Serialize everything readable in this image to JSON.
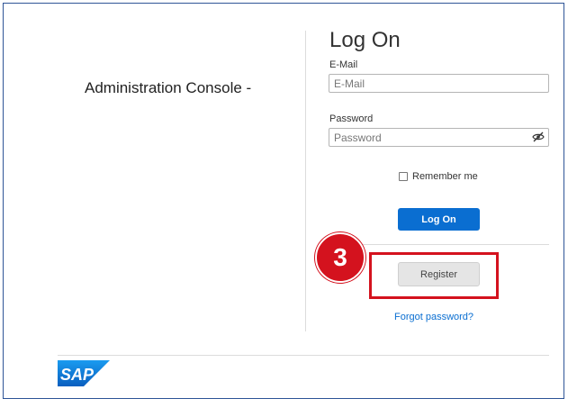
{
  "console": {
    "title": "Administration Console -"
  },
  "login": {
    "title": "Log On",
    "email_label": "E-Mail",
    "email_placeholder": "E-Mail",
    "password_label": "Password",
    "password_placeholder": "Password",
    "remember_label": "Remember me",
    "logon_button": "Log On",
    "register_button": "Register",
    "forgot_link": "Forgot password?"
  },
  "annotation": {
    "step_number": "3",
    "highlight_color": "#d4121e"
  },
  "icons": {
    "password_toggle": "eye-slash-icon",
    "brand": "sap-logo"
  },
  "logo": {
    "text": "SAP"
  },
  "colors": {
    "primary": "#0a6ed1",
    "frame_border": "#2f5597"
  }
}
